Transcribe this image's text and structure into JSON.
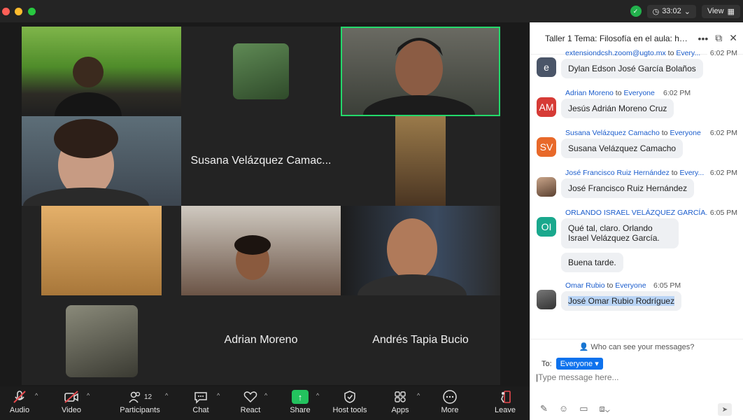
{
  "titlebar": {
    "timer": "33:02",
    "view_label": "View",
    "icons": [
      "shield-icon",
      "clock-icon",
      "grid-icon"
    ]
  },
  "tiles": [
    {
      "name": "",
      "kind": "video"
    },
    {
      "name": "",
      "kind": "photo"
    },
    {
      "name": "",
      "kind": "video",
      "active": true
    },
    {
      "name": "",
      "kind": "video"
    },
    {
      "name": "Susana Velázquez Camac...",
      "kind": "name"
    },
    {
      "name": "",
      "kind": "video"
    },
    {
      "name": "",
      "kind": "video"
    },
    {
      "name": "",
      "kind": "video"
    },
    {
      "name": "",
      "kind": "video"
    },
    {
      "name": "",
      "kind": "photo"
    },
    {
      "name": "Adrian Moreno",
      "kind": "name"
    },
    {
      "name": "Andrés Tapia Bucio",
      "kind": "name"
    }
  ],
  "toolbar": {
    "audio": "Audio",
    "video": "Video",
    "participants": "Participants",
    "participants_count": "12",
    "chat": "Chat",
    "react": "React",
    "share": "Share",
    "host_tools": "Host tools",
    "apps": "Apps",
    "more": "More",
    "leave": "Leave"
  },
  "chat": {
    "title": "Taller 1  Tema: Filosofía en el aula: haci...",
    "messages": [
      {
        "sender": "extensiondcsh.zoom@ugto.mx",
        "to": "to",
        "recipient": "Every...",
        "time": "6:02 PM",
        "initials": "e",
        "color": "#4a5568",
        "text": "Dylan Edson José García Bolaños"
      },
      {
        "sender": "Adrian Moreno",
        "to": "to",
        "recipient": "Everyone",
        "time": "6:02 PM",
        "initials": "AM",
        "color": "#d63b36",
        "text": "Jesús Adrián Moreno Cruz"
      },
      {
        "sender": "Susana Velázquez Camacho",
        "to": "to",
        "recipient": "Everyone",
        "time": "6:02 PM",
        "initials": "SV",
        "color": "#e8692a",
        "text": "Susana Velázquez Camacho"
      },
      {
        "sender": "José Francisco Ruiz Hernández",
        "to": "to",
        "recipient": "Every...",
        "time": "6:02 PM",
        "initials": "",
        "color": "#777777",
        "text": "José Francisco Ruiz Hernández"
      },
      {
        "sender": "ORLANDO ISRAEL VELÁZQUEZ GARCÍA...",
        "to": "",
        "recipient": "",
        "time": "6:05 PM",
        "initials": "OI",
        "color": "#1aa88d",
        "text": "Qué tal, claro. Orlando Israel Velázquez García.",
        "extra": "Buena tarde."
      },
      {
        "sender": "Omar Rubio",
        "to": "to",
        "recipient": "Everyone",
        "time": "6:05 PM",
        "initials": "",
        "color": "#555555",
        "text": "José Omar Rubio Rodríguez"
      }
    ],
    "who_can_see": "Who can see your messages?",
    "to_label": "To:",
    "to_value": "Everyone",
    "input_placeholder": "Type message here..."
  }
}
